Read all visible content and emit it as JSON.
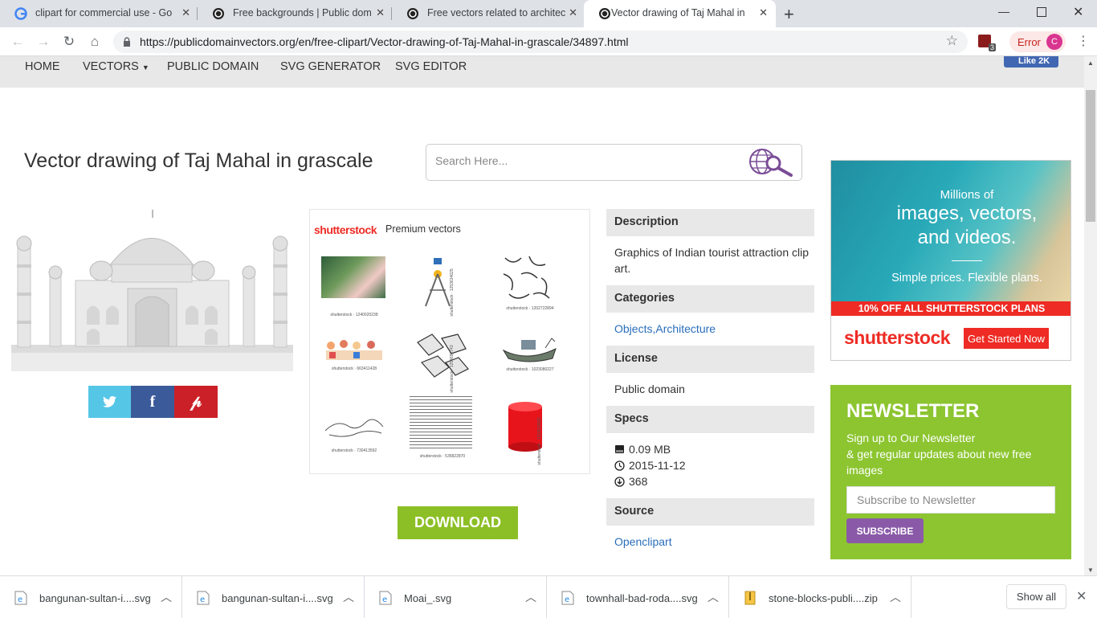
{
  "browser": {
    "tabs": [
      {
        "title": "clipart for commercial use - Goog",
        "favicon": "google-icon"
      },
      {
        "title": "Free backgrounds | Public domai",
        "favicon": "pdv-icon"
      },
      {
        "title": "Free vectors related to architectu",
        "favicon": "pdv-icon"
      },
      {
        "title": "Vector drawing of Taj Mahal in gr",
        "favicon": "pdv-icon",
        "active": true
      }
    ],
    "url": "https://publicdomainvectors.org/en/free-clipart/Vector-drawing-of-Taj-Mahal-in-grascale/34897.html",
    "extension_badge": "3",
    "profile_status": "Error",
    "profile_initial": "C"
  },
  "site_nav": {
    "items": [
      "HOME",
      "VECTORS",
      "PUBLIC DOMAIN",
      "SVG GENERATOR",
      "SVG EDITOR"
    ],
    "fb_like": "Like 2K"
  },
  "page": {
    "title": "Vector drawing of Taj Mahal in grascale",
    "search_placeholder": "Search Here..."
  },
  "share": {
    "twitter": "twitter-icon",
    "facebook": "facebook-icon",
    "pinterest": "pinterest-icon",
    "colors": {
      "twitter": "#55c6e6",
      "facebook": "#3b5a9a",
      "pinterest": "#cb2027"
    }
  },
  "shutterstock_panel": {
    "logo": "shutterstock",
    "label": "Premium vectors",
    "captions": [
      "shutterstock · 1240020238",
      "shutterstock · 1253634625",
      "shutterstock · 1202722894",
      "shutterstock · 663411428",
      "shutterstock · 1254692743",
      "shutterstock · 1023080227",
      "shutterstock · 730413592",
      "shutterstock · 535822870",
      "shutterstock · 1253634599"
    ]
  },
  "download_label": "DOWNLOAD",
  "info": {
    "description_head": "Description",
    "description": "Graphics of Indian tourist attraction clip art.",
    "categories_head": "Categories",
    "categories": "Objects,Architecture",
    "license_head": "License",
    "license": "Public domain",
    "specs_head": "Specs",
    "size": "0.09 MB",
    "date": "2015-11-12",
    "downloads": "368",
    "source_head": "Source",
    "source": "Openclipart"
  },
  "ad": {
    "line1": "Millions of",
    "line2": "images, vectors,",
    "line3": "and videos.",
    "line4": "Simple prices. Flexible plans.",
    "bar": "10% OFF ALL SHUTTERSTOCK PLANS",
    "logo": "shutterstock",
    "cta": "Get Started Now"
  },
  "newsletter": {
    "title": "NEWSLETTER",
    "desc1": "Sign up to Our Newsletter",
    "desc2": "& get regular updates about new free images",
    "placeholder": "Subscribe to Newsletter",
    "button": "SUBSCRIBE"
  },
  "downloads_bar": {
    "items": [
      {
        "name": "bangunan-sultan-i....svg",
        "icon": "ie-file-icon"
      },
      {
        "name": "bangunan-sultan-i....svg",
        "icon": "ie-file-icon"
      },
      {
        "name": "Moai_.svg",
        "icon": "ie-file-icon"
      },
      {
        "name": "townhall-bad-roda....svg",
        "icon": "ie-file-icon"
      },
      {
        "name": "stone-blocks-publi....zip",
        "icon": "zip-file-icon"
      }
    ],
    "show_all": "Show all"
  }
}
